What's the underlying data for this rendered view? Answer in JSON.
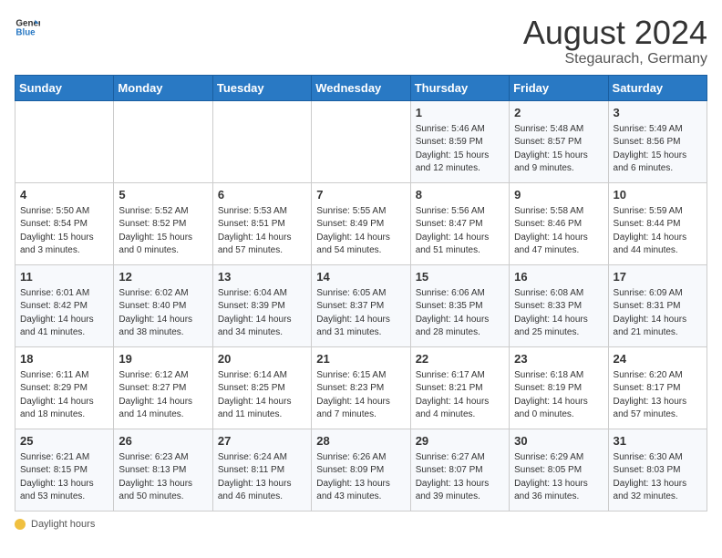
{
  "header": {
    "logo_line1": "General",
    "logo_line2": "Blue",
    "month_year": "August 2024",
    "location": "Stegaurach, Germany"
  },
  "weekdays": [
    "Sunday",
    "Monday",
    "Tuesday",
    "Wednesday",
    "Thursday",
    "Friday",
    "Saturday"
  ],
  "footer": {
    "daylight_label": "Daylight hours"
  },
  "weeks": [
    [
      {
        "day": "",
        "sunrise": "",
        "sunset": "",
        "daylight": ""
      },
      {
        "day": "",
        "sunrise": "",
        "sunset": "",
        "daylight": ""
      },
      {
        "day": "",
        "sunrise": "",
        "sunset": "",
        "daylight": ""
      },
      {
        "day": "",
        "sunrise": "",
        "sunset": "",
        "daylight": ""
      },
      {
        "day": "1",
        "sunrise": "Sunrise: 5:46 AM",
        "sunset": "Sunset: 8:59 PM",
        "daylight": "Daylight: 15 hours and 12 minutes."
      },
      {
        "day": "2",
        "sunrise": "Sunrise: 5:48 AM",
        "sunset": "Sunset: 8:57 PM",
        "daylight": "Daylight: 15 hours and 9 minutes."
      },
      {
        "day": "3",
        "sunrise": "Sunrise: 5:49 AM",
        "sunset": "Sunset: 8:56 PM",
        "daylight": "Daylight: 15 hours and 6 minutes."
      }
    ],
    [
      {
        "day": "4",
        "sunrise": "Sunrise: 5:50 AM",
        "sunset": "Sunset: 8:54 PM",
        "daylight": "Daylight: 15 hours and 3 minutes."
      },
      {
        "day": "5",
        "sunrise": "Sunrise: 5:52 AM",
        "sunset": "Sunset: 8:52 PM",
        "daylight": "Daylight: 15 hours and 0 minutes."
      },
      {
        "day": "6",
        "sunrise": "Sunrise: 5:53 AM",
        "sunset": "Sunset: 8:51 PM",
        "daylight": "Daylight: 14 hours and 57 minutes."
      },
      {
        "day": "7",
        "sunrise": "Sunrise: 5:55 AM",
        "sunset": "Sunset: 8:49 PM",
        "daylight": "Daylight: 14 hours and 54 minutes."
      },
      {
        "day": "8",
        "sunrise": "Sunrise: 5:56 AM",
        "sunset": "Sunset: 8:47 PM",
        "daylight": "Daylight: 14 hours and 51 minutes."
      },
      {
        "day": "9",
        "sunrise": "Sunrise: 5:58 AM",
        "sunset": "Sunset: 8:46 PM",
        "daylight": "Daylight: 14 hours and 47 minutes."
      },
      {
        "day": "10",
        "sunrise": "Sunrise: 5:59 AM",
        "sunset": "Sunset: 8:44 PM",
        "daylight": "Daylight: 14 hours and 44 minutes."
      }
    ],
    [
      {
        "day": "11",
        "sunrise": "Sunrise: 6:01 AM",
        "sunset": "Sunset: 8:42 PM",
        "daylight": "Daylight: 14 hours and 41 minutes."
      },
      {
        "day": "12",
        "sunrise": "Sunrise: 6:02 AM",
        "sunset": "Sunset: 8:40 PM",
        "daylight": "Daylight: 14 hours and 38 minutes."
      },
      {
        "day": "13",
        "sunrise": "Sunrise: 6:04 AM",
        "sunset": "Sunset: 8:39 PM",
        "daylight": "Daylight: 14 hours and 34 minutes."
      },
      {
        "day": "14",
        "sunrise": "Sunrise: 6:05 AM",
        "sunset": "Sunset: 8:37 PM",
        "daylight": "Daylight: 14 hours and 31 minutes."
      },
      {
        "day": "15",
        "sunrise": "Sunrise: 6:06 AM",
        "sunset": "Sunset: 8:35 PM",
        "daylight": "Daylight: 14 hours and 28 minutes."
      },
      {
        "day": "16",
        "sunrise": "Sunrise: 6:08 AM",
        "sunset": "Sunset: 8:33 PM",
        "daylight": "Daylight: 14 hours and 25 minutes."
      },
      {
        "day": "17",
        "sunrise": "Sunrise: 6:09 AM",
        "sunset": "Sunset: 8:31 PM",
        "daylight": "Daylight: 14 hours and 21 minutes."
      }
    ],
    [
      {
        "day": "18",
        "sunrise": "Sunrise: 6:11 AM",
        "sunset": "Sunset: 8:29 PM",
        "daylight": "Daylight: 14 hours and 18 minutes."
      },
      {
        "day": "19",
        "sunrise": "Sunrise: 6:12 AM",
        "sunset": "Sunset: 8:27 PM",
        "daylight": "Daylight: 14 hours and 14 minutes."
      },
      {
        "day": "20",
        "sunrise": "Sunrise: 6:14 AM",
        "sunset": "Sunset: 8:25 PM",
        "daylight": "Daylight: 14 hours and 11 minutes."
      },
      {
        "day": "21",
        "sunrise": "Sunrise: 6:15 AM",
        "sunset": "Sunset: 8:23 PM",
        "daylight": "Daylight: 14 hours and 7 minutes."
      },
      {
        "day": "22",
        "sunrise": "Sunrise: 6:17 AM",
        "sunset": "Sunset: 8:21 PM",
        "daylight": "Daylight: 14 hours and 4 minutes."
      },
      {
        "day": "23",
        "sunrise": "Sunrise: 6:18 AM",
        "sunset": "Sunset: 8:19 PM",
        "daylight": "Daylight: 14 hours and 0 minutes."
      },
      {
        "day": "24",
        "sunrise": "Sunrise: 6:20 AM",
        "sunset": "Sunset: 8:17 PM",
        "daylight": "Daylight: 13 hours and 57 minutes."
      }
    ],
    [
      {
        "day": "25",
        "sunrise": "Sunrise: 6:21 AM",
        "sunset": "Sunset: 8:15 PM",
        "daylight": "Daylight: 13 hours and 53 minutes."
      },
      {
        "day": "26",
        "sunrise": "Sunrise: 6:23 AM",
        "sunset": "Sunset: 8:13 PM",
        "daylight": "Daylight: 13 hours and 50 minutes."
      },
      {
        "day": "27",
        "sunrise": "Sunrise: 6:24 AM",
        "sunset": "Sunset: 8:11 PM",
        "daylight": "Daylight: 13 hours and 46 minutes."
      },
      {
        "day": "28",
        "sunrise": "Sunrise: 6:26 AM",
        "sunset": "Sunset: 8:09 PM",
        "daylight": "Daylight: 13 hours and 43 minutes."
      },
      {
        "day": "29",
        "sunrise": "Sunrise: 6:27 AM",
        "sunset": "Sunset: 8:07 PM",
        "daylight": "Daylight: 13 hours and 39 minutes."
      },
      {
        "day": "30",
        "sunrise": "Sunrise: 6:29 AM",
        "sunset": "Sunset: 8:05 PM",
        "daylight": "Daylight: 13 hours and 36 minutes."
      },
      {
        "day": "31",
        "sunrise": "Sunrise: 6:30 AM",
        "sunset": "Sunset: 8:03 PM",
        "daylight": "Daylight: 13 hours and 32 minutes."
      }
    ]
  ]
}
